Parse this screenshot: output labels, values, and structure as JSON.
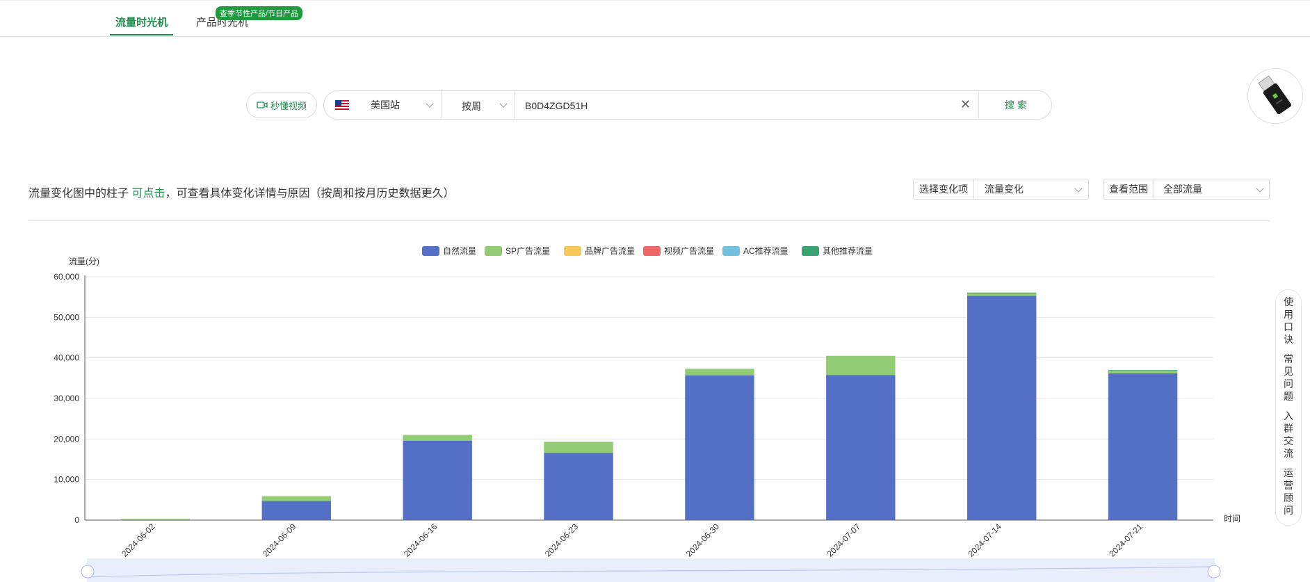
{
  "tabs": {
    "active": "流量时光机",
    "second": "产品时光机",
    "badge": "查季节性产品/节日产品"
  },
  "search": {
    "video_button": "秒懂视频",
    "site": "美国站",
    "period": "按周",
    "query": "B0D4ZGD51H",
    "search_button": "搜 索"
  },
  "hint": {
    "before": "流量变化图中的柱子 ",
    "link": "可点击",
    "after": "，可查看具体变化详情与原因（按周和按月历史数据更久）"
  },
  "filters": {
    "change_label": "选择变化项",
    "change_value": "流量变化",
    "scope_label": "查看范围",
    "scope_value": "全部流量"
  },
  "rail": [
    "使用口诀",
    "常见问题",
    "入群交流",
    "运营顾问"
  ],
  "colors": {
    "accent": "#1f8f4e",
    "natural": "#5470c6",
    "sp": "#91cc75",
    "brand": "#fac858",
    "video": "#ee6666",
    "ac": "#73c0de",
    "other": "#3ba272"
  },
  "chart_data": {
    "type": "bar",
    "stacked": true,
    "ylabel": "流量(分)",
    "xlabel": "时间",
    "ylim": [
      0,
      60000
    ],
    "yticks": [
      "0",
      "10,000",
      "20,000",
      "30,000",
      "40,000",
      "50,000",
      "60,000"
    ],
    "legend_position": "top-center",
    "grid": true,
    "categories": [
      "2024-06-02",
      "2024-06-09",
      "2024-06-16",
      "2024-06-23",
      "2024-06-30",
      "2024-07-07",
      "2024-07-14",
      "2024-07-21"
    ],
    "series": [
      {
        "name": "自然流量",
        "color": "#5470c6",
        "values": [
          100,
          4700,
          19600,
          16600,
          35700,
          35800,
          55300,
          36200
        ]
      },
      {
        "name": "SP广告流量",
        "color": "#91cc75",
        "values": [
          200,
          1200,
          1400,
          2700,
          1600,
          4700,
          600,
          600
        ]
      },
      {
        "name": "品牌广告流量",
        "color": "#fac858",
        "values": [
          0,
          0,
          0,
          0,
          0,
          0,
          0,
          0
        ]
      },
      {
        "name": "视频广告流量",
        "color": "#ee6666",
        "values": [
          0,
          0,
          0,
          0,
          0,
          0,
          0,
          0
        ]
      },
      {
        "name": "AC推荐流量",
        "color": "#73c0de",
        "values": [
          0,
          0,
          0,
          0,
          0,
          0,
          0,
          0
        ]
      },
      {
        "name": "其他推荐流量",
        "color": "#3ba272",
        "values": [
          0,
          0,
          0,
          0,
          0,
          0,
          200,
          200
        ]
      }
    ]
  }
}
